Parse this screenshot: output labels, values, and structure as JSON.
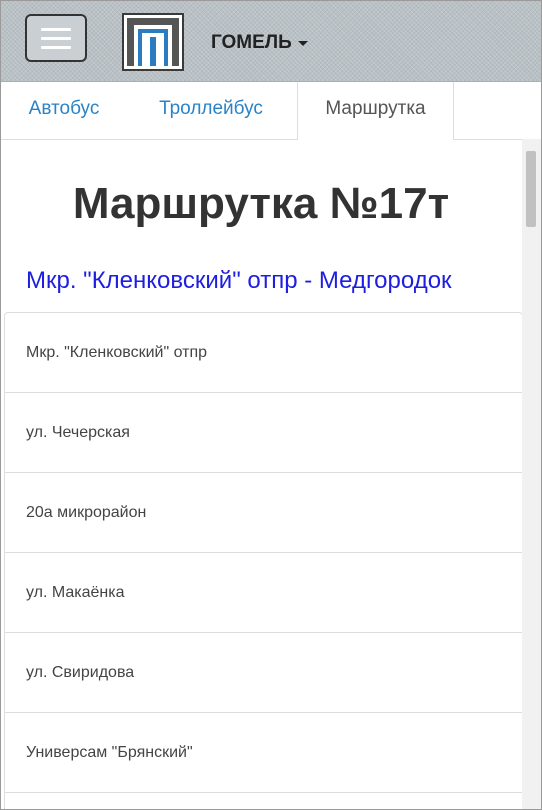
{
  "header": {
    "menu_icon": "hamburger-icon",
    "logo_icon": "city-logo",
    "city": "ГОМЕЛЬ"
  },
  "tabs": [
    {
      "label": "Автобус",
      "active": false
    },
    {
      "label": "Троллейбус",
      "active": false
    },
    {
      "label": "Маршрутка",
      "active": true
    }
  ],
  "page": {
    "title": "Маршрутка №17т",
    "route_name": "Мкр. \"Кленковский\" отпр - Медгородок"
  },
  "stops": [
    "Мкр. \"Кленковский\" отпр",
    "ул. Чечерская",
    "20а микрорайон",
    "ул. Макаёнка",
    "ул. Свиридова",
    "Универсам \"Брянский\""
  ],
  "colors": {
    "link": "#2a83c7",
    "route": "#1e1ee0",
    "header_bg": "#b9c1c6"
  }
}
